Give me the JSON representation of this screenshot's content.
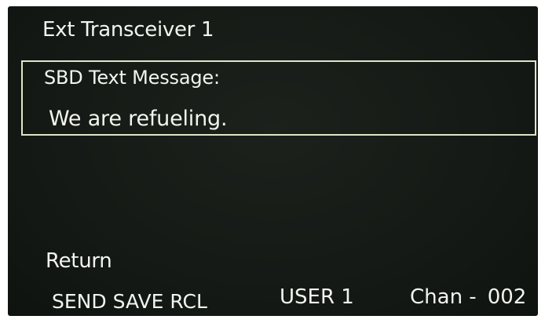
{
  "header": {
    "title": "Ext Transceiver 1"
  },
  "message": {
    "label": "SBD Text Message:",
    "text": "We are refueling."
  },
  "nav": {
    "return_label": "Return"
  },
  "softkeys": [
    {
      "label": "SEND"
    },
    {
      "label": "SAVE"
    },
    {
      "label": "RCL"
    }
  ],
  "status": {
    "user": "USER 1",
    "chan_prefix": "Chan -",
    "chan_value": "002"
  },
  "colors": {
    "screen_bg": "#151a15",
    "text": "#f2f4ee",
    "box_border": "#dfe5c9"
  }
}
